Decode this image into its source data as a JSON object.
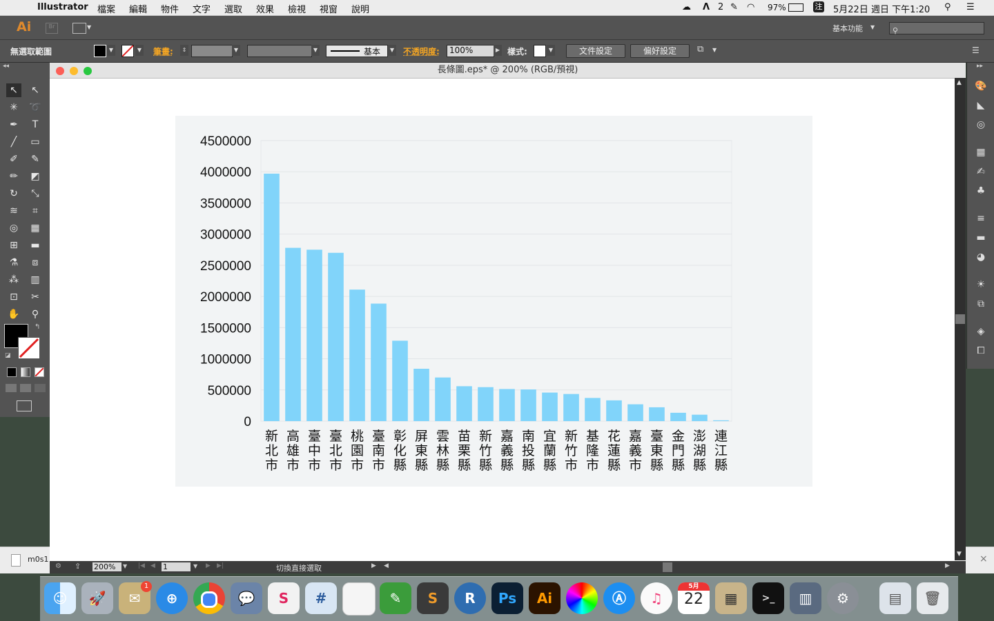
{
  "menubar": {
    "app": "Illustrator",
    "items": [
      "檔案",
      "編輯",
      "物件",
      "文字",
      "選取",
      "效果",
      "檢視",
      "視窗",
      "說明"
    ],
    "status_number": "2",
    "battery": "97%",
    "date_time": "5月22日 週日 下午1:20"
  },
  "appbar": {
    "logo": "Ai",
    "workspace": "基本功能"
  },
  "ctrlbar": {
    "selection": "無選取範圍",
    "stroke_label": "筆畫:",
    "stroke_style": "基本",
    "opacity_label": "不透明度:",
    "opacity_value": "100%",
    "style_label": "樣式:",
    "doc_setup": "文件設定",
    "preferences": "偏好設定"
  },
  "document": {
    "title": "長條圖.eps* @ 200% (RGB/預視)",
    "zoom": "200%",
    "artboard": "1",
    "status_text": "切換直接選取"
  },
  "sidebar_file": "m0s1",
  "chart_data": {
    "type": "bar",
    "bar_color": "#81d4fa",
    "ylim": [
      0,
      4500000
    ],
    "y_ticks": [
      "4500000",
      "4000000",
      "3500000",
      "3000000",
      "2500000",
      "2000000",
      "1500000",
      "1000000",
      "500000",
      "0"
    ],
    "categories": [
      "新北市",
      "高雄市",
      "臺中市",
      "臺北市",
      "桃園市",
      "臺南市",
      "彰化縣",
      "屏東縣",
      "雲林縣",
      "苗栗縣",
      "新竹縣",
      "嘉義縣",
      "南投縣",
      "宜蘭縣",
      "新竹市",
      "基隆市",
      "花蓮縣",
      "嘉義市",
      "臺東縣",
      "金門縣",
      "澎湖縣",
      "連江縣"
    ],
    "values": [
      3970000,
      2780000,
      2750000,
      2700000,
      2110000,
      1885000,
      1290000,
      840000,
      700000,
      560000,
      545000,
      515000,
      508000,
      458000,
      435000,
      372000,
      333000,
      270000,
      222000,
      134000,
      103000,
      13000
    ]
  },
  "dock": {
    "badge": "1",
    "calendar_month": "5月",
    "calendar_day": "22",
    "labels": [
      "Ps",
      "Ai",
      "R",
      "S",
      "#"
    ]
  },
  "colors": {
    "panel": "#535353",
    "accent": "#f5a623"
  }
}
